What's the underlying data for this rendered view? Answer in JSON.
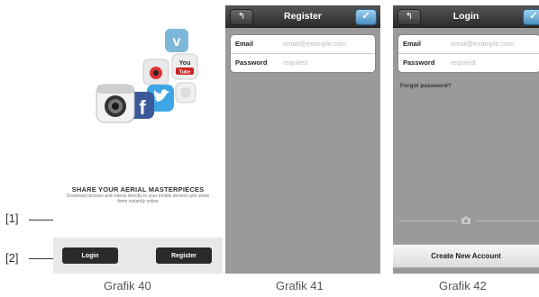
{
  "screen40": {
    "headline": "SHARE YOUR AERIAL MASTERPIECES",
    "subline": "Download pictures and videos directly to your mobile devices and share them instantly online",
    "login_label": "Login",
    "register_label": "Register",
    "icons": [
      "camera-icon",
      "facebook-icon",
      "twitter-icon",
      "youtube-icon",
      "vimeo-icon",
      "weibo-icon",
      "chat-icon"
    ],
    "icon_text": {
      "facebook": "f",
      "youtube": "You Tube",
      "vimeo": "v"
    }
  },
  "screen41": {
    "title": "Register",
    "email_label": "Email",
    "email_placeholder": "email@example.com",
    "password_label": "Password",
    "password_placeholder": "required",
    "back_glyph": "↰",
    "done_glyph": "✓"
  },
  "screen42": {
    "title": "Login",
    "email_label": "Email",
    "email_placeholder": "email@example.com",
    "password_label": "Password",
    "password_placeholder": "required",
    "forgot_label": "Forgot password?",
    "create_label": "Create New Account",
    "back_glyph": "↰",
    "done_glyph": "✓"
  },
  "callouts": {
    "one": "[1]",
    "two": "[2]"
  },
  "captions": {
    "c40": "Grafik 40",
    "c41": "Grafik 41",
    "c42": "Grafik 42"
  }
}
